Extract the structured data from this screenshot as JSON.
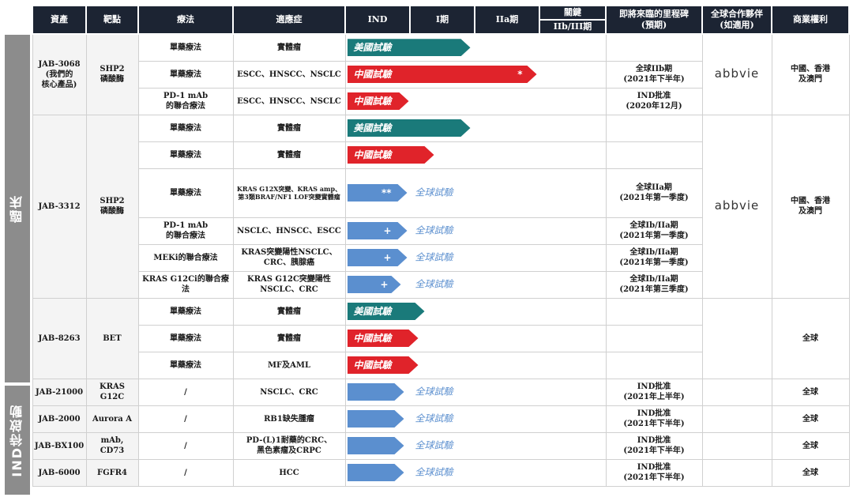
{
  "sections": {
    "clinical": "臨床",
    "ind_pending": "IND待啟動"
  },
  "headers": {
    "asset": "資產",
    "target": "靶點",
    "therapy": "療法",
    "indication": "適應症",
    "ind": "IND",
    "phase1": "I期",
    "phase2a": "IIa期",
    "pivotal": "關鍵",
    "pivotal_sub": "IIb/III期",
    "milestone": "即將來臨的里程碑",
    "milestone_sub": "(預期)",
    "partner": "全球合作夥伴",
    "partner_sub": "(如適用)",
    "rights": "商業權利"
  },
  "groups": {
    "jab3068": {
      "asset": "JAB-3068",
      "asset_note": "(我們的",
      "asset_note2": "核心產品)",
      "target": "SHP2",
      "target_sub": "磷酸酶",
      "partner": "abbvie",
      "rights": "中國、香港",
      "rights2": "及澳門"
    },
    "jab3312": {
      "asset": "JAB-3312",
      "target": "SHP2",
      "target_sub": "磷酸酶",
      "partner": "abbvie",
      "rights": "中國、香港",
      "rights2": "及澳門"
    },
    "jab8263": {
      "asset": "JAB-8263",
      "target": "BET",
      "rights": "全球"
    }
  },
  "rows": [
    {
      "therapy": "單藥療法",
      "indication": "實體瘤",
      "bar": "美國試驗",
      "milestone": ""
    },
    {
      "therapy": "單藥療法",
      "indication": "ESCC、HNSCC、NSCLC",
      "bar": "中國試驗",
      "mark": "*",
      "milestone": "全球IIb期",
      "milestone2": "(2021年下半年)"
    },
    {
      "therapy": "PD-1 mAb",
      "therapy2": "的聯合療法",
      "indication": "ESCC、HNSCC、NSCLC",
      "bar": "中國試驗",
      "milestone": "IND批准",
      "milestone2": "(2020年12月)"
    },
    {
      "therapy": "單藥療法",
      "indication": "實體瘤",
      "bar": "美國試驗",
      "milestone": ""
    },
    {
      "therapy": "單藥療法",
      "indication": "實體瘤",
      "bar": "中國試驗",
      "milestone": ""
    },
    {
      "therapy": "單藥療法",
      "indication": "KRAS G12X突變、KRAS amp、",
      "indication2": "第3類BRAF/NF1 LOF突變實體瘤",
      "mark": "**",
      "global": "全球試驗",
      "milestone": "全球IIa期",
      "milestone2": "(2021年第一季度)"
    },
    {
      "therapy": "PD-1 mAb",
      "therapy2": "的聯合療法",
      "indication": "NSCLC、HNSCC、ESCC",
      "mark": "+",
      "global": "全球試驗",
      "milestone": "全球Ib/IIa期",
      "milestone2": "(2021年第一季度)"
    },
    {
      "therapy": "MEKi的聯合療法",
      "indication": "KRAS突變陽性NSCLC、",
      "indication2": "CRC、胰腺癌",
      "mark": "+",
      "global": "全球試驗",
      "milestone": "全球Ib/IIa期",
      "milestone2": "(2021年第一季度)"
    },
    {
      "therapy": "KRAS G12Ci的聯合療法",
      "indication": "KRAS G12C突變陽性",
      "indication2": "NSCLC、CRC",
      "mark": "+",
      "global": "全球試驗",
      "milestone": "全球Ib/IIa期",
      "milestone2": "(2021年第三季度)"
    },
    {
      "therapy": "單藥療法",
      "indication": "實體瘤",
      "bar": "美國試驗"
    },
    {
      "therapy": "單藥療法",
      "indication": "實體瘤",
      "bar": "中國試驗"
    },
    {
      "therapy": "單藥療法",
      "indication": "MF及AML",
      "bar": "中國試驗"
    },
    {
      "asset": "JAB-21000",
      "target": "KRAS G12C",
      "therapy": "/",
      "indication": "NSCLC、CRC",
      "global": "全球試驗",
      "milestone": "IND批准",
      "milestone2": "(2021年上半年)",
      "rights": "全球"
    },
    {
      "asset": "JAB-2000",
      "target": "Aurora A",
      "therapy": "/",
      "indication": "RB1缺失腫瘤",
      "global": "全球試驗",
      "milestone": "IND批准",
      "milestone2": "(2021年下半年)",
      "rights": "全球"
    },
    {
      "asset": "JAB-BX100",
      "target": "mAb, CD73",
      "therapy": "/",
      "indication": "PD-(L)1耐藥的CRC、",
      "indication2": "黑色素瘤及CRPC",
      "global": "全球試驗",
      "milestone": "IND批准",
      "milestone2": "(2021年下半年)",
      "rights": "全球"
    },
    {
      "asset": "JAB-6000",
      "target": "FGFR4",
      "therapy": "/",
      "indication": "HCC",
      "global": "全球試驗",
      "milestone": "IND批准",
      "milestone2": "(2021年下半年)",
      "rights": "全球"
    }
  ],
  "colors": {
    "us_trial": "#1a7a7a",
    "china_trial": "#e0232a",
    "global_trial": "#5b8fcf",
    "header": "#1c2433",
    "section": "#8c8c8c"
  }
}
